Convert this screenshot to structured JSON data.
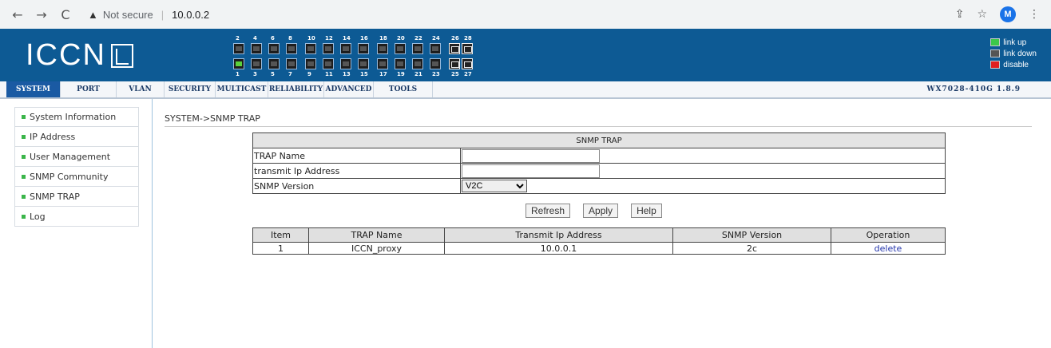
{
  "browser": {
    "security_label": "Not secure",
    "url": "10.0.0.2",
    "profile_initial": "M"
  },
  "header": {
    "logo_text": "ICCN",
    "port_top_numbers": [
      "2",
      "4",
      "6",
      "8",
      "10",
      "12",
      "14",
      "16",
      "18",
      "20",
      "22",
      "24",
      "26",
      "28"
    ],
    "port_bottom_numbers": [
      "1",
      "3",
      "5",
      "7",
      "9",
      "11",
      "13",
      "15",
      "17",
      "19",
      "21",
      "23",
      "25",
      "27"
    ],
    "legend": {
      "up_label": "link up",
      "down_label": "link down",
      "disable_label": "disable",
      "up_color": "#3cc84a",
      "down_color": "#555555",
      "disable_color": "#e02020"
    }
  },
  "menu": {
    "items": [
      "SYSTEM",
      "PORT",
      "VLAN",
      "SECURITY",
      "MULTICAST",
      "RELIABILITY",
      "ADVANCED",
      "TOOLS"
    ],
    "active": "SYSTEM",
    "version": "WX7028-410G 1.8.9"
  },
  "sidebar": {
    "items": [
      "System Information",
      "IP Address",
      "User Management",
      "SNMP Community",
      "SNMP TRAP",
      "Log"
    ]
  },
  "content": {
    "breadcrumb": "SYSTEM->SNMP TRAP",
    "form": {
      "title": "SNMP TRAP",
      "trap_name_label": "TRAP Name",
      "trap_name_value": "",
      "ip_label": "transmit Ip Address",
      "ip_value": "",
      "version_label": "SNMP Version",
      "version_selected": "V2C"
    },
    "buttons": {
      "refresh": "Refresh",
      "apply": "Apply",
      "help": "Help"
    },
    "table": {
      "headers": [
        "Item",
        "TRAP Name",
        "Transmit Ip Address",
        "SNMP Version",
        "Operation"
      ],
      "rows": [
        {
          "item": "1",
          "trap_name": "ICCN_proxy",
          "ip": "10.0.0.1",
          "version": "2c",
          "operation": "delete"
        }
      ]
    }
  }
}
